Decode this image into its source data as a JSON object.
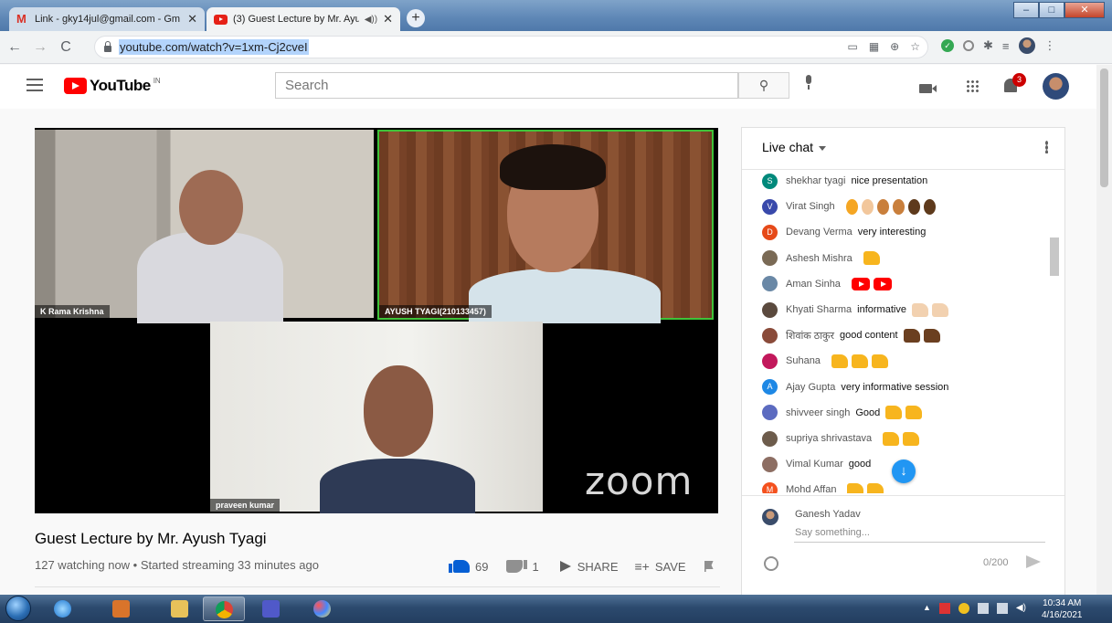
{
  "browser": {
    "tabs": [
      {
        "title": "Link - gky14jul@gmail.com - Gm",
        "icon": "gmail-icon",
        "active": false
      },
      {
        "title": "(3) Guest Lecture by Mr. Ayu",
        "icon": "youtube-icon",
        "active": true
      }
    ],
    "url": "youtube.com/watch?v=1xm-Cj2cveI"
  },
  "youtube": {
    "region": "IN",
    "search_placeholder": "Search",
    "notifications_count": "3"
  },
  "video": {
    "participants": [
      {
        "name": "K Rama Krishna"
      },
      {
        "name": "AYUSH TYAGI(210133457)"
      },
      {
        "name": "praveen kumar"
      }
    ],
    "watermark": "zoom",
    "title": "Guest Lecture by Mr. Ayush Tyagi",
    "meta": "127 watching now • Started streaming 33 minutes ago",
    "likes": "69",
    "dislikes": "1",
    "share_label": "SHARE",
    "save_label": "SAVE"
  },
  "chat": {
    "header": "Live chat",
    "messages": [
      {
        "author": "shekhar tyagi",
        "text": "nice presentation",
        "avatar_letter": "S",
        "avatar_color": "#00897b",
        "emojis": []
      },
      {
        "author": "Virat Singh",
        "text": "",
        "avatar_letter": "V",
        "avatar_color": "#3949ab",
        "emojis": [
          "ok-hand",
          "ok-hand-light",
          "ok-hand-medium",
          "ok-hand-medium-dark",
          "ok-hand-dark",
          "ok-hand-darkest"
        ]
      },
      {
        "author": "Devang Verma",
        "text": "very interesting",
        "avatar_letter": "D",
        "avatar_color": "#e64a19",
        "emojis": []
      },
      {
        "author": "Ashesh Mishra",
        "text": "",
        "avatar_letter": "",
        "avatar_color": "#7a6a55",
        "emojis": [
          "thumbs-up"
        ]
      },
      {
        "author": "Aman Sinha",
        "text": "",
        "avatar_letter": "",
        "avatar_color": "#6a88a6",
        "emojis": [
          "youtube-logo",
          "youtube-logo"
        ]
      },
      {
        "author": "Khyati Sharma",
        "text": "informative",
        "avatar_letter": "",
        "avatar_color": "#5b4a3e",
        "emojis": [
          "thumbs-up-light",
          "thumbs-up-light"
        ]
      },
      {
        "author": "शिवांक ठाकुर",
        "text": "good content",
        "avatar_letter": "",
        "avatar_color": "#8a4b3a",
        "emojis": [
          "thumbs-up-dark",
          "thumbs-up-dark"
        ]
      },
      {
        "author": "Suhana",
        "text": "",
        "avatar_letter": "",
        "avatar_color": "#c2185b",
        "emojis": [
          "thumbs-up",
          "thumbs-up",
          "thumbs-up"
        ]
      },
      {
        "author": "Ajay Gupta",
        "text": "very informative session",
        "avatar_letter": "A",
        "avatar_color": "#1e88e5",
        "emojis": []
      },
      {
        "author": "shivveer singh",
        "text": "Good",
        "avatar_letter": "",
        "avatar_color": "#5c6bc0",
        "emojis": [
          "thumbs-up",
          "thumbs-up"
        ]
      },
      {
        "author": "supriya shrivastava",
        "text": "",
        "avatar_letter": "",
        "avatar_color": "#6d5c4c",
        "emojis": [
          "thumbs-up",
          "thumbs-up"
        ]
      },
      {
        "author": "Vimal Kumar",
        "text": "good",
        "avatar_letter": "",
        "avatar_color": "#8d6e63",
        "emojis": []
      },
      {
        "author": "Mohd Affan",
        "text": "",
        "avatar_letter": "M",
        "avatar_color": "#f4511e",
        "emojis": [
          "thumbs-up",
          "thumbs-up"
        ]
      }
    ],
    "current_user": "Ganesh Yadav",
    "input_placeholder": "Say something...",
    "char_counter": "0/200"
  },
  "taskbar": {
    "time": "10:34 AM",
    "date": "4/16/2021"
  }
}
